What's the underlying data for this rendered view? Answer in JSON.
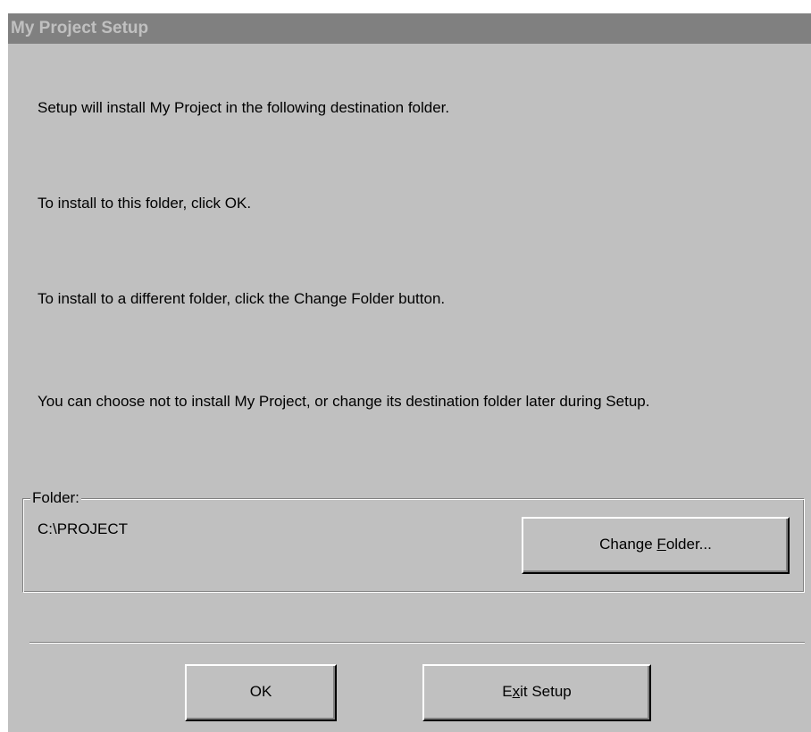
{
  "window": {
    "title": "My Project Setup"
  },
  "messages": {
    "line1": "Setup will install My Project in the following destination folder.",
    "line2": "To install to this folder, click OK.",
    "line3": "To install to a different folder, click the Change Folder button.",
    "line4": "You can choose not to install My Project, or change its destination folder later during Setup."
  },
  "folder_group": {
    "label": "Folder:",
    "path": "C:\\PROJECT",
    "change_button": {
      "pre": "Change ",
      "accel": "F",
      "post": "older..."
    }
  },
  "buttons": {
    "ok_label": "OK",
    "exit": {
      "pre": "E",
      "accel": "x",
      "post": "it Setup"
    }
  },
  "colors": {
    "face": "#c0c0c0",
    "titlebar_inactive": "#808080",
    "title_text": "#c0c0c0"
  }
}
